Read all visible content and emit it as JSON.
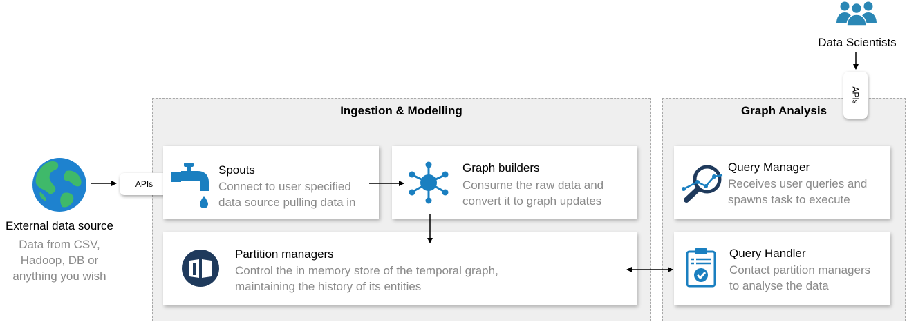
{
  "regions": {
    "ingestion": {
      "title": "Ingestion & Modelling"
    },
    "analysis": {
      "title": "Graph Analysis"
    }
  },
  "external_source": {
    "title": "External data source",
    "description_lines": [
      "Data from CSV,",
      "Hadoop, DB or",
      "anything you wish"
    ]
  },
  "data_scientists": {
    "title": "Data Scientists"
  },
  "apis_label": "APIs",
  "cards": {
    "spouts": {
      "title": "Spouts",
      "lines": [
        "Connect to user specified",
        "data source pulling data in"
      ]
    },
    "graph_builders": {
      "title": "Graph builders",
      "lines": [
        "Consume the raw data and",
        "convert it to graph updates"
      ]
    },
    "partition_managers": {
      "title": "Partition managers",
      "lines": [
        "Control the in memory store of the temporal graph,",
        "maintaining the history of its entities"
      ]
    },
    "query_manager": {
      "title": "Query Manager",
      "lines": [
        "Receives user queries and",
        "spawns task to execute"
      ]
    },
    "query_handler": {
      "title": "Query Handler",
      "lines": [
        "Contact partition managers",
        "to analyse the data"
      ]
    }
  },
  "colors": {
    "icon_blue": "#1a7fc0",
    "icon_navy": "#1f3a5c",
    "people_teal": "#2a87b5",
    "globe_ocean": "#1e82cf",
    "globe_land": "#3fb96a"
  }
}
